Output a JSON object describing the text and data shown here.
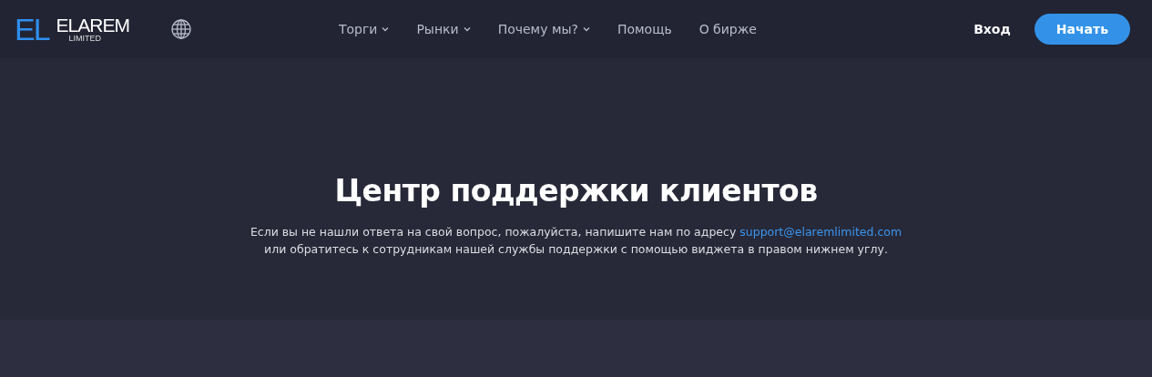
{
  "header": {
    "logo": {
      "mark": "EL",
      "name": "ELAREM",
      "subtitle": "LIMITED"
    },
    "nav": [
      {
        "label": "Торги",
        "dropdown": true
      },
      {
        "label": "Рынки",
        "dropdown": true
      },
      {
        "label": "Почему мы?",
        "dropdown": true
      },
      {
        "label": "Помощь",
        "dropdown": false
      },
      {
        "label": "О бирже",
        "dropdown": false
      }
    ],
    "login": "Вход",
    "start": "Начать"
  },
  "hero": {
    "title": "Центр поддержки клиентов",
    "text_before": "Если вы не нашли ответа на свой вопрос, пожалуйста, напишите нам по адресу ",
    "email": "support@elaremlimited.com",
    "text_after": "или обратитесь к сотрудникам нашей службы поддержки с помощью виджета в правом нижнем углу."
  }
}
